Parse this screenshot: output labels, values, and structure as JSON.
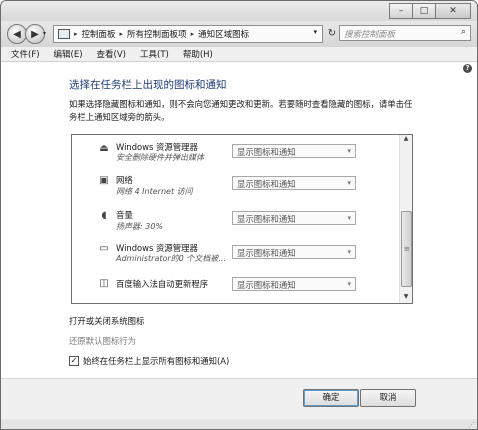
{
  "window": {
    "caption": {
      "minimize": "–",
      "maximize": "□",
      "close": "✕"
    }
  },
  "nav": {
    "back_glyph": "◀",
    "forward_glyph": "▶",
    "recent_glyph": "▾",
    "breadcrumb": [
      "控制面板",
      "所有控制面板项",
      "通知区域图标"
    ],
    "crumb_sep": "▸",
    "address_dd": "▾",
    "refresh_glyph": "↻",
    "search_placeholder": "搜索控制面板",
    "search_glyph": "⌕"
  },
  "menu": [
    "文件(F)",
    "编辑(E)",
    "查看(V)",
    "工具(T)",
    "帮助(H)"
  ],
  "help_glyph": "?",
  "page": {
    "title": "选择在任务栏上出现的图标和通知",
    "description": "如果选择隐藏图标和通知，则不会向您通知更改和更新。若要随时查看隐藏的图标，请单击任务栏上通知区域旁的箭头。"
  },
  "list": {
    "rows": [
      {
        "icon": "usb-eject-icon",
        "glyph": "⏏",
        "name": "Windows 资源管理器",
        "sub": "安全删除硬件并弹出媒体",
        "behavior": "显示图标和通知"
      },
      {
        "icon": "network-icon",
        "glyph": "▣",
        "name": "网络",
        "sub": "网络 4 Internet 访问",
        "behavior": "显示图标和通知"
      },
      {
        "icon": "speaker-icon",
        "glyph": "◖",
        "name": "音量",
        "sub": "扬声器: 30%",
        "behavior": "显示图标和通知"
      },
      {
        "icon": "computer-icon",
        "glyph": "▭",
        "name": "Windows 资源管理器",
        "sub": "Administrator的0 个文档被...",
        "behavior": "显示图标和通知"
      },
      {
        "icon": "ime-update-icon",
        "glyph": "◫",
        "name": "百度输入法自动更新程序",
        "sub": "",
        "behavior": "显示图标和通知"
      }
    ],
    "dd_arrow": "▾",
    "scroll": {
      "up": "▲",
      "down": "▼",
      "grip": "≡"
    }
  },
  "links": {
    "system_icons": "打开或关闭系统图标",
    "restore_default": "还原默认图标行为"
  },
  "always_show": {
    "label": "始终在任务栏上显示所有图标和通知(A)",
    "checked": true,
    "check_glyph": "✓"
  },
  "buttons": {
    "ok": "确定",
    "cancel": "取消"
  },
  "resize_grip": "⋰"
}
